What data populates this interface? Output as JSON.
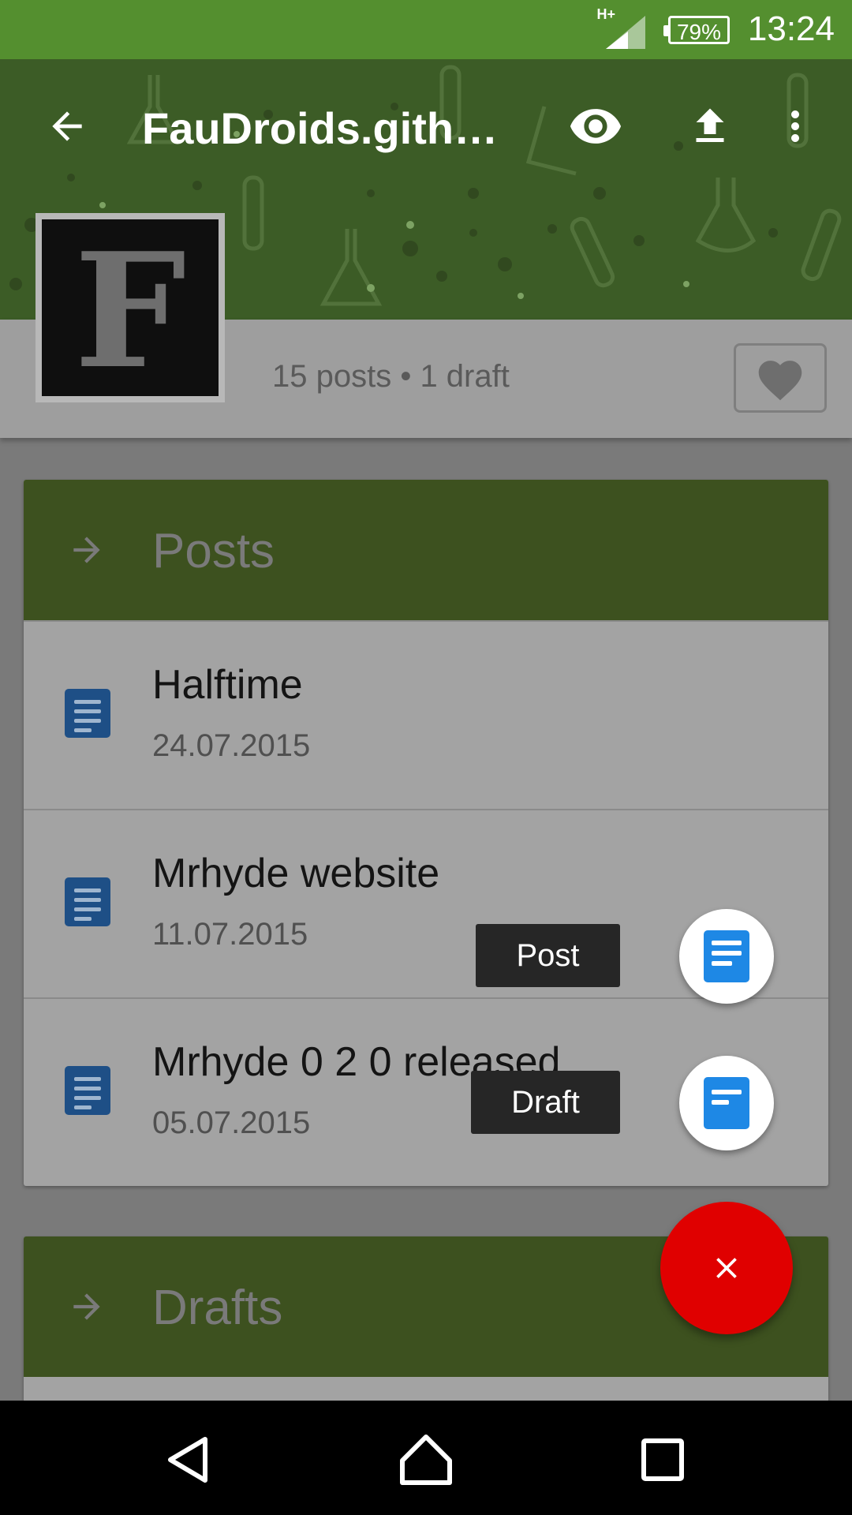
{
  "status_bar": {
    "network": "H+",
    "battery": "79%",
    "time": "13:24"
  },
  "app_bar": {
    "title": "FauDroids.githu…",
    "icons": [
      "back-arrow-icon",
      "eye-icon",
      "upload-icon",
      "more-vert-icon"
    ]
  },
  "profile": {
    "logo_letter": "F",
    "stats": "15 posts • 1 draft"
  },
  "posts_section": {
    "header": "Posts",
    "items": [
      {
        "title": "Halftime",
        "date": "24.07.2015"
      },
      {
        "title": "Mrhyde website",
        "date": "11.07.2015"
      },
      {
        "title": "Mrhyde 0 2 0 released",
        "date": "05.07.2015"
      }
    ]
  },
  "drafts_section": {
    "header": "Drafts"
  },
  "fab_menu": {
    "post_label": "Post",
    "draft_label": "Draft",
    "close_symbol": "×"
  },
  "colors": {
    "status_bar": "#548f2f",
    "header_dimmed": "#3c5c26",
    "fab": "#e00000",
    "mini_fab_icon": "#1e88e5"
  }
}
